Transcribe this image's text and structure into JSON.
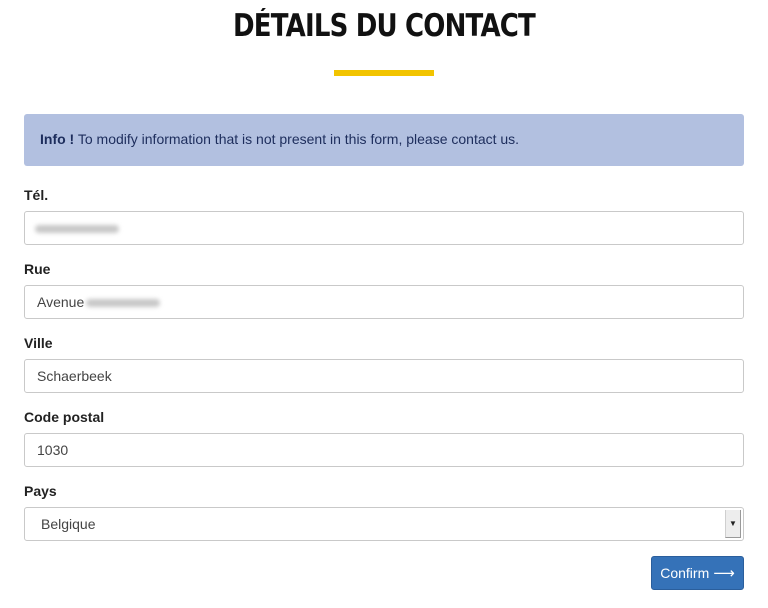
{
  "page": {
    "title": "DÉTAILS DU CONTACT"
  },
  "info": {
    "label": "Info !",
    "message": "To modify information that is not present in this form, please contact us."
  },
  "fields": {
    "tel": {
      "label": "Tél.",
      "value": ""
    },
    "rue": {
      "label": "Rue",
      "value": "Avenue"
    },
    "ville": {
      "label": "Ville",
      "value": "Schaerbeek"
    },
    "code_postal": {
      "label": "Code postal",
      "value": "1030"
    },
    "pays": {
      "label": "Pays",
      "value": "Belgique"
    }
  },
  "actions": {
    "confirm_label": "Confirm",
    "confirm_icon": "arrow-right-icon"
  },
  "colors": {
    "accent_rule": "#f2c400",
    "info_bg": "#b2c0e0",
    "info_text": "#1d2d5c",
    "button_bg": "#3572b8"
  }
}
